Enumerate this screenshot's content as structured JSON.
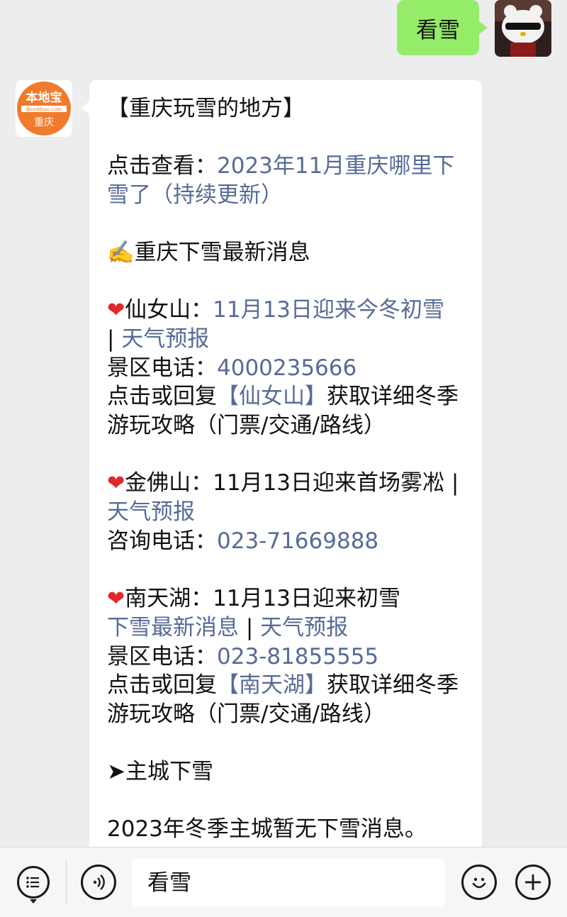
{
  "outgoing": {
    "text": "看雪"
  },
  "bot": {
    "logo_top": "本地宝",
    "logo_mid": "Bendibao.com",
    "logo_bottom": "重庆"
  },
  "message": {
    "title": "【重庆玩雪的地方】",
    "click_view_label": "点击查看：",
    "click_view_link": "2023年11月重庆哪里下雪了（持续更新）",
    "latest_icon": "✍️",
    "latest_title": "重庆下雪最新消息",
    "heart": "❤",
    "xiannv": {
      "name": "仙女山：",
      "news_link": "11月13日迎来今冬初雪",
      "sep": "|",
      "weather_link": "天气预报",
      "phone_label": "景区电话：",
      "phone": "4000235666",
      "reply_pre": "点击或回复",
      "reply_link": "【仙女山】",
      "reply_post": "获取详细冬季游玩攻略（门票/交通/路线）"
    },
    "jinfo": {
      "name": "金佛山：",
      "news": "11月13日迎来首场雾凇",
      "sep": "|",
      "weather_link": "天气预报",
      "phone_label": "咨询电话：",
      "phone": "023-71669888"
    },
    "nantian": {
      "name": "南天湖：",
      "news": "11月13日迎来初雪",
      "news_link": "下雪最新消息",
      "sep": "|",
      "weather_link": "天气预报",
      "phone_label": "景区电话：",
      "phone": "023-81855555",
      "reply_pre": "点击或回复",
      "reply_link": "【南天湖】",
      "reply_post": "获取详细冬季游玩攻略（门票/交通/路线）"
    },
    "city_arrow": "➤",
    "city_title": "主城下雪",
    "city_note": "2023年冬季主城暂无下雪消息。"
  },
  "input_bar": {
    "text": "看雪"
  },
  "colors": {
    "link": "#576b95",
    "outgoing_bubble": "#95ec69",
    "logo": "#f07b2c"
  }
}
